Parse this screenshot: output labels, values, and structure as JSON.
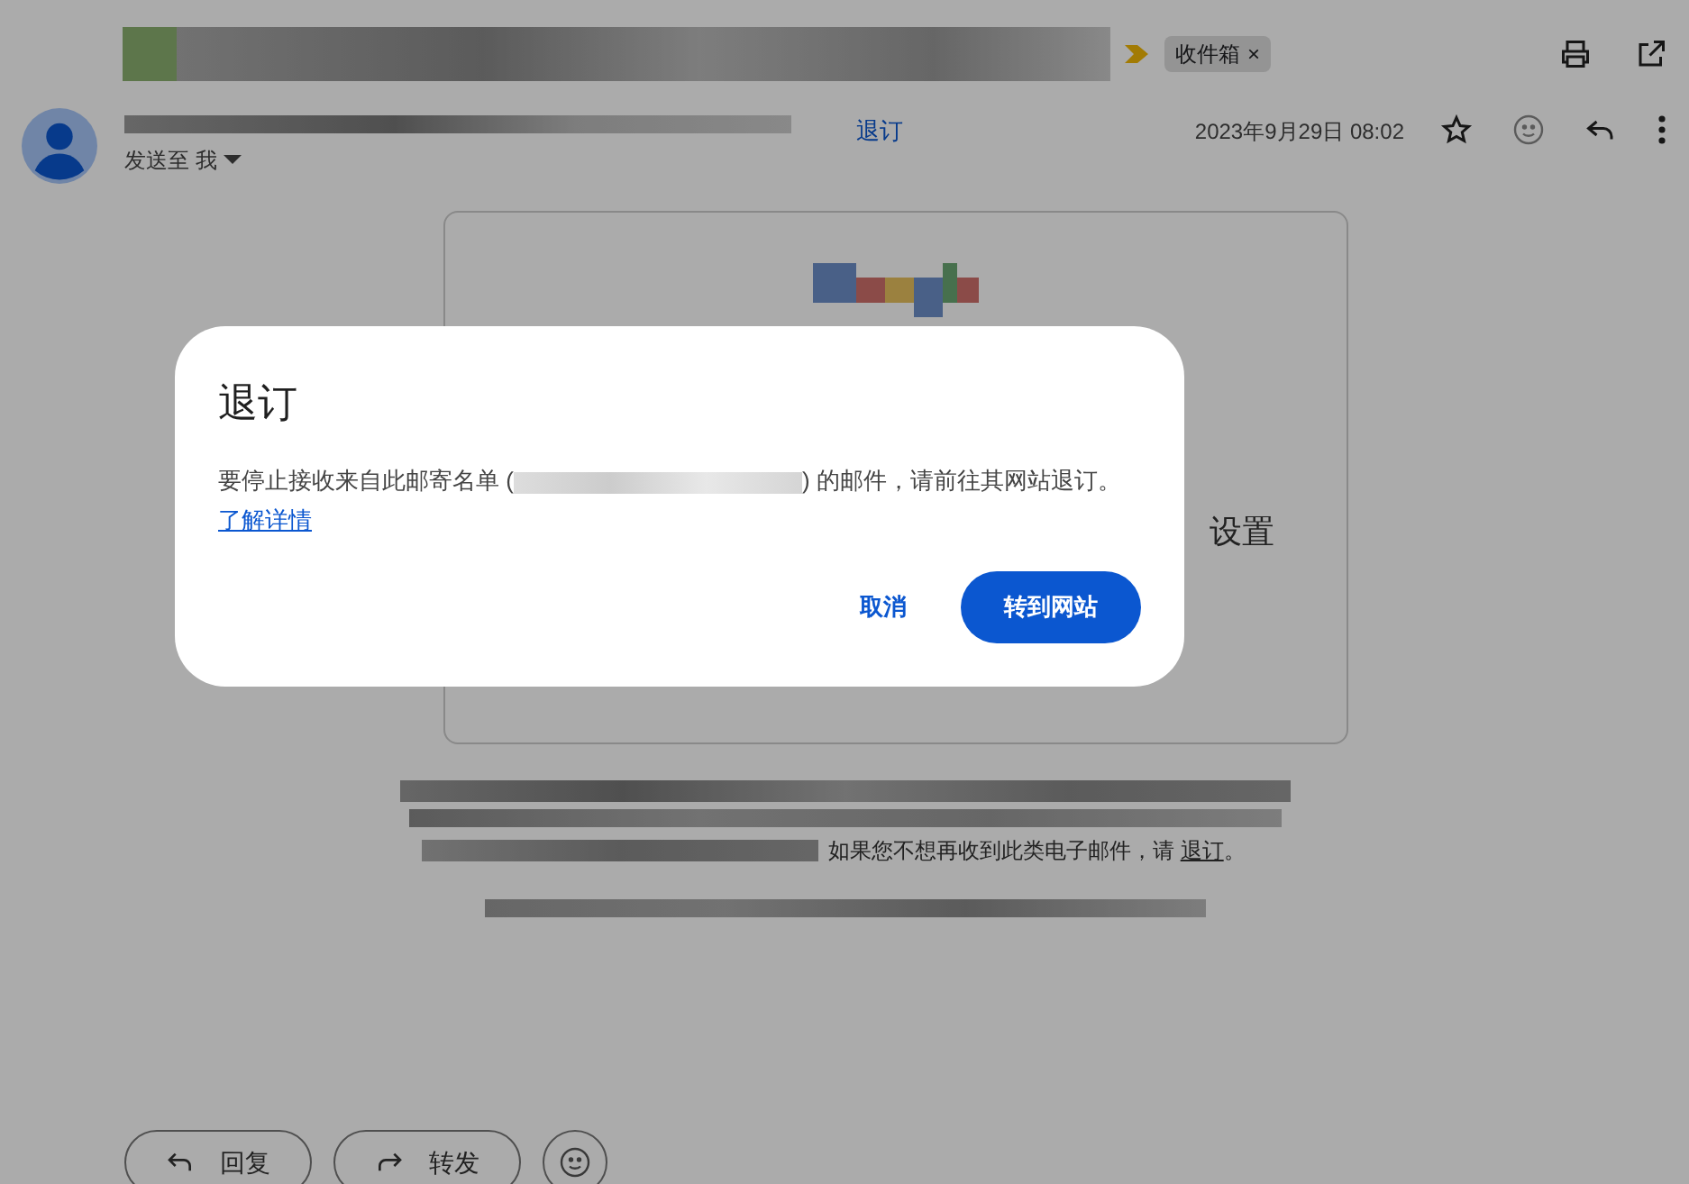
{
  "header": {
    "label_chip": "收件箱",
    "label_chip_close": "×"
  },
  "sender": {
    "unsubscribe_link": "退订",
    "recipient": "发送至 我",
    "date": "2023年9月29日 08:02"
  },
  "email_body": {
    "heading_fragment": "设置",
    "footer_text": "如果您不想再收到此类电子邮件，请",
    "footer_link": "退订",
    "footer_end": "。"
  },
  "actions": [
    {
      "label": "回复",
      "kind": "reply"
    },
    {
      "label": "转发",
      "kind": "forward"
    }
  ],
  "dialog": {
    "title": "退订",
    "message_start": "要停止接收来自此邮寄名单 (",
    "message_end": ") 的邮件，请前往其网站退订。",
    "link": "了解详情",
    "buttons": [
      {
        "label": "取消",
        "kind": "text"
      },
      {
        "label": "转到网站",
        "kind": "filled"
      }
    ]
  }
}
